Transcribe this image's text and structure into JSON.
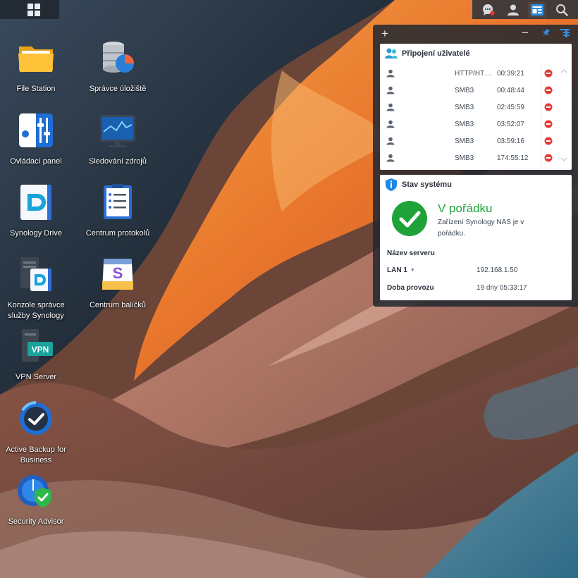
{
  "taskbar": {
    "main_menu_icon": "grid-icon",
    "right_icons": [
      "notification-chat-icon",
      "user-icon",
      "widgets-icon",
      "search-icon"
    ]
  },
  "desktop": {
    "icons": [
      {
        "label": "File Station",
        "icon": "folder-icon"
      },
      {
        "label": "Správce úložiště",
        "icon": "storage-manager-icon"
      },
      {
        "label": "Ovládací panel",
        "icon": "control-panel-icon"
      },
      {
        "label": "Sledování zdrojů",
        "icon": "resource-monitor-icon"
      },
      {
        "label": "Synology Drive",
        "icon": "synology-drive-icon"
      },
      {
        "label": "Centrum protokolů",
        "icon": "log-center-icon"
      },
      {
        "label": "Konzole správce služby Synology",
        "icon": "drive-admin-console-icon"
      },
      {
        "label": "Centrum balíčků",
        "icon": "package-center-icon"
      },
      {
        "label": "VPN Server",
        "icon": "vpn-server-icon"
      },
      {
        "label": "Active Backup for Business",
        "icon": "active-backup-icon"
      },
      {
        "label": "Security Advisor",
        "icon": "security-advisor-icon"
      }
    ]
  },
  "widget_panel": {
    "add_label": "+",
    "minimize_label": "−",
    "connections": {
      "title": "Připojení uživatelé",
      "rows": [
        {
          "protocol": "HTTP/HTTPS",
          "time": "00:39:21"
        },
        {
          "protocol": "SMB3",
          "time": "00:48:44"
        },
        {
          "protocol": "SMB3",
          "time": "02:45:59"
        },
        {
          "protocol": "SMB3",
          "time": "03:52:07"
        },
        {
          "protocol": "SMB3",
          "time": "03:59:16"
        },
        {
          "protocol": "SMB3",
          "time": "174:55:12"
        }
      ]
    },
    "system_status": {
      "title": "Stav systému",
      "status": "V pořádku",
      "description": "Zařízení Synology NAS je v pořádku.",
      "server_name_label": "Název serveru",
      "server_name_value": "",
      "lan_label": "LAN 1",
      "lan_value": "192.168.1.50",
      "uptime_label": "Doba provozu",
      "uptime_value": "19 dny 05:33:17"
    }
  },
  "colors": {
    "accent": "#1e88e5",
    "ok_green": "#1fa339",
    "disconnect_red": "#e53935"
  }
}
